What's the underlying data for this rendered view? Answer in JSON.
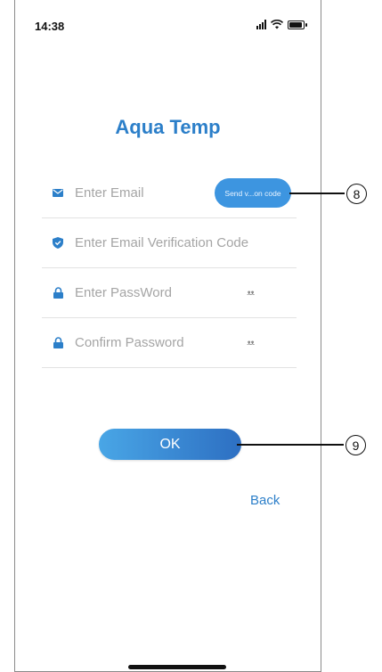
{
  "status_bar": {
    "time": "14:38"
  },
  "app": {
    "title": "Aqua Temp"
  },
  "form": {
    "email_placeholder": "Enter Email",
    "send_code_label": "Send v...on code",
    "code_placeholder": "Enter Email Verification Code",
    "password_placeholder": "Enter PassWord",
    "confirm_placeholder": "Confirm Password",
    "eye_icon_glyph": "ᴥᴥ"
  },
  "actions": {
    "ok_label": "OK",
    "back_label": "Back"
  },
  "callouts": {
    "send_code": "8",
    "ok": "9"
  },
  "colors": {
    "accent": "#2c7fc9",
    "button": "#3d95e0",
    "placeholder": "#a5a5a5"
  },
  "icons": {
    "email": "envelope-icon",
    "code": "shield-icon",
    "password": "lock-icon",
    "confirm": "lock-icon",
    "toggle": "eye-closed-icon"
  }
}
